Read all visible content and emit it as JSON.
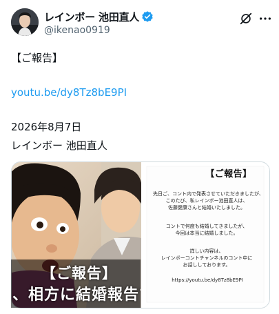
{
  "author": {
    "display_name": "レインボー 池田直人",
    "handle": "@ikenao0919",
    "verified": true
  },
  "icons": {
    "verified": "verified-badge-icon",
    "grok": "grok-icon",
    "more": "more-icon"
  },
  "colors": {
    "link": "#1d9bf0",
    "verified": "#1d9bf0",
    "secondary_text": "#536471"
  },
  "tweet": {
    "line1": "【ご報告】",
    "link": "youtu.be/dy8Tz8bE9PI",
    "date": "2026年8月7日",
    "signature": "レインボー 池田直人"
  },
  "media": {
    "card_title": "【ご報告】",
    "card_lines": [
      "先日ご、コント内で発表させていただきましたが、",
      "このたび、私レインボー池田直人は、",
      "佐藤健康さんと結婚いたしました。",
      "コントで何度も結婚してきましたが、",
      "今回は本当に結婚しました。",
      "詳しい内容は、",
      "レインボーコントチャンネルのコント中に",
      "お話ししております。"
    ],
    "card_url": "https://youtu.be/dy8Tz8bE9PI",
    "overlay_line1": "【ご報告】",
    "overlay_line2": "、相方に結婚報告で"
  }
}
